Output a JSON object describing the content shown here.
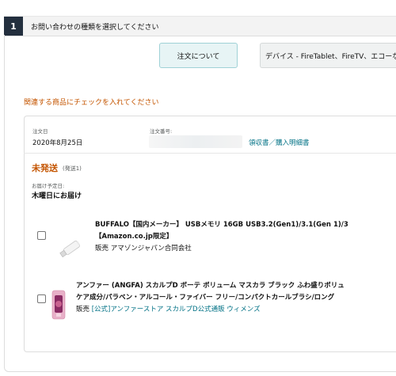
{
  "step": {
    "number": "1",
    "title": "お問い合わせの種類を選択してください"
  },
  "categories": {
    "selected": "注文について",
    "device": "デバイス - FireTablet、FireTV、エコーな"
  },
  "prompt": "関連する商品にチェックを入れてください",
  "order": {
    "date_label": "注文日",
    "date_value": "2020年8月25日",
    "number_label": "注文番号:",
    "receipt_link": "領収書／購入明細書",
    "status": "未発送",
    "status_count": "(発送1)",
    "delivery_label": "お届け予定日:",
    "delivery_value": "木曜日にお届け"
  },
  "items": [
    {
      "title_line1": "BUFFALO【国内メーカー】 USBメモリ 16GB USB3.2(Gen1)/3.1(Gen 1)/3",
      "title_line2": "【Amazon.co.jp限定】",
      "seller_prefix": "販売",
      "seller": "アマゾンジャパン合同会社"
    },
    {
      "title_line1": "アンファー (ANGFA) スカルプD ボーテ ボリューム マスカラ ブラック ふわ盛りボリュ",
      "title_line2": "ケア成分/パラベン・アルコール・ファイバー フリー/コンパクトカールブラシ/ロング",
      "seller_prefix": "販売",
      "seller": "[公式]アンファーストア スカルプD公式通販 ウィメンズ"
    }
  ],
  "colors": {
    "accent": "#c45500",
    "link": "#007185",
    "step_bg": "#232f3e",
    "selected_bg": "#e7f4f5"
  }
}
